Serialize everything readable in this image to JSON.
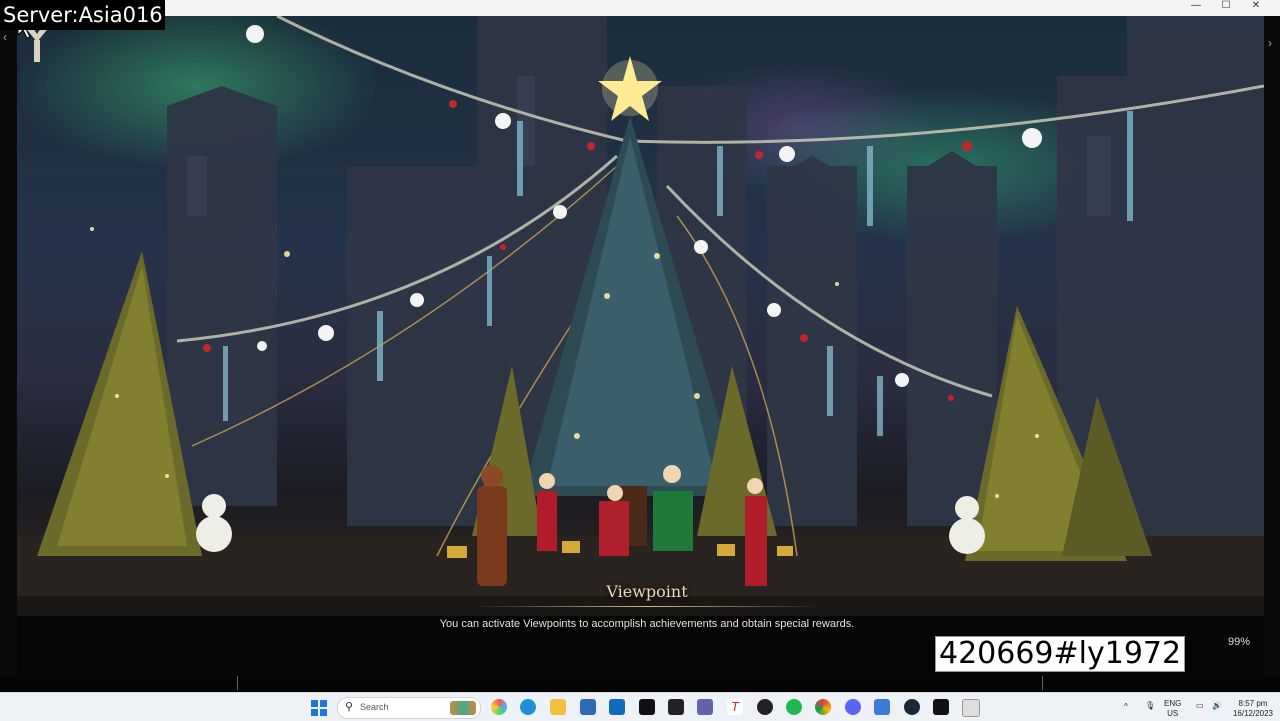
{
  "window": {
    "controls": {
      "minimize": "—",
      "maximize": "☐",
      "close": "✕"
    }
  },
  "overlay": {
    "server_label": "Server:Asia016",
    "watermark": "420669#ly1972"
  },
  "game": {
    "viewpoint_title": "Viewpoint",
    "viewpoint_desc": "You can activate Viewpoints to accomplish achievements and obtain special rewards.",
    "loading_progress": "99%"
  },
  "taskbar": {
    "search_placeholder": "Search",
    "language": "ENG",
    "region": "US",
    "time": "8:57 pm",
    "date": "16/12/2023"
  }
}
